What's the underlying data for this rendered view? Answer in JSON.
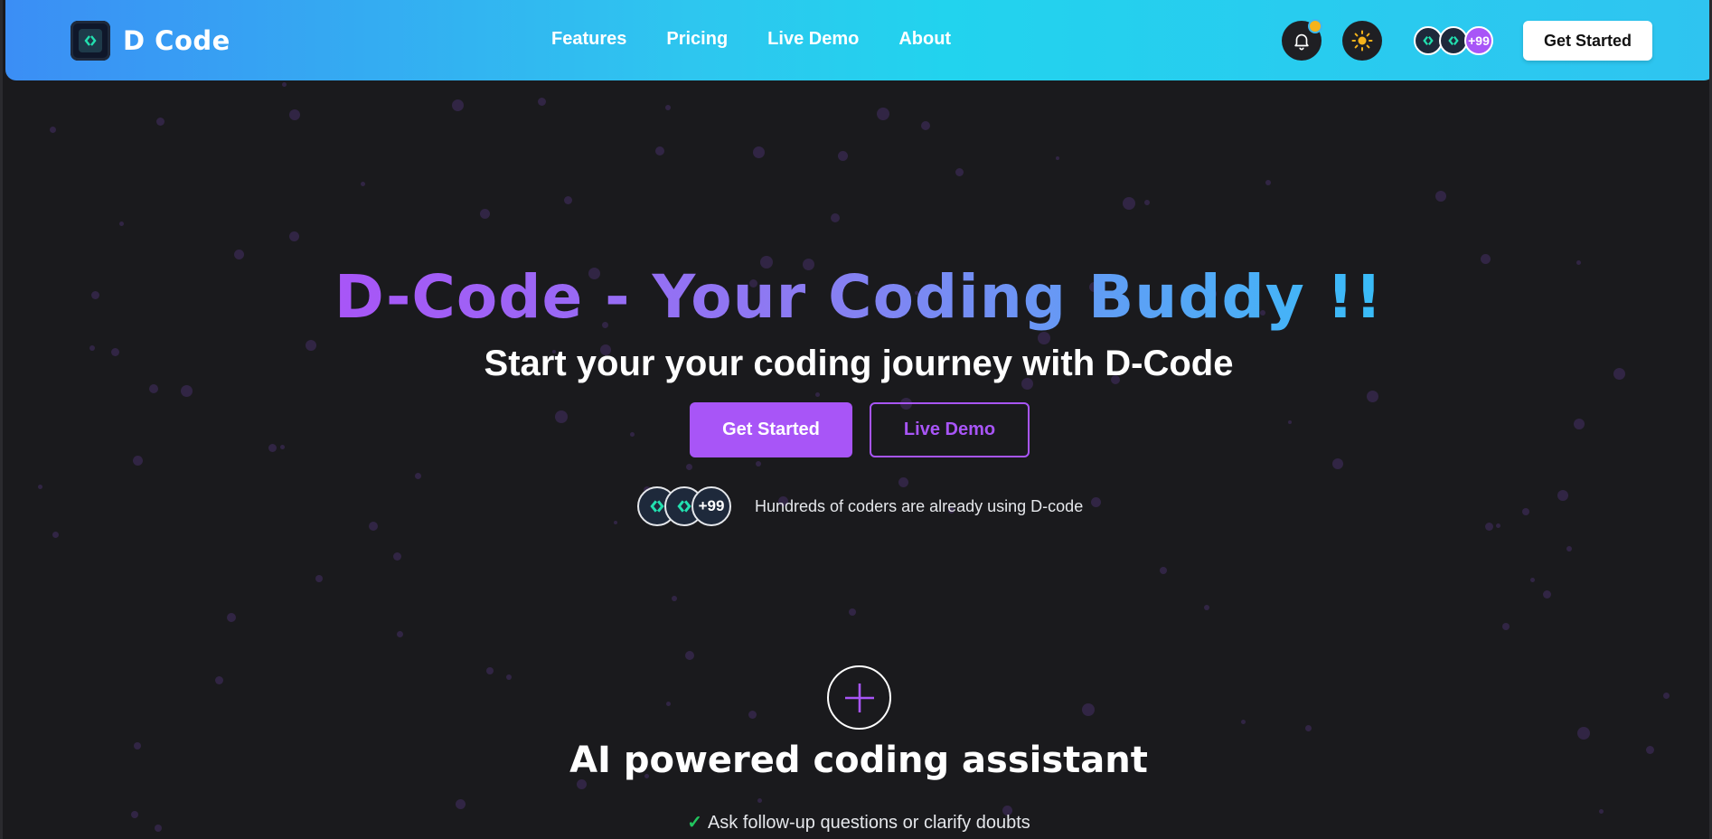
{
  "brand": {
    "name": "D Code"
  },
  "nav": {
    "items": [
      "Features",
      "Pricing",
      "Live Demo",
      "About"
    ]
  },
  "header": {
    "notification_icon": "bell-icon",
    "theme_icon": "sun-icon",
    "avatar_count": "+99",
    "cta_label": "Get Started"
  },
  "hero": {
    "title": "D-Code - Your Coding Buddy !!",
    "subtitle": "Start your your coding journey with D-Code",
    "primary_button": "Get Started",
    "secondary_button": "Live Demo",
    "avatar_count": "+99",
    "social_proof": "Hundreds of coders are already using D-code"
  },
  "feature": {
    "icon": "plus-icon",
    "title": "AI powered coding assistant",
    "points": [
      "Ask follow-up questions or clarify doubts"
    ]
  },
  "colors": {
    "accent": "#a855f7",
    "header_gradient_start": "#3b8ef5",
    "header_gradient_end": "#22d3ee",
    "background": "#1a1a1d",
    "check": "#22c55e",
    "notification_dot": "#f5b31b"
  }
}
